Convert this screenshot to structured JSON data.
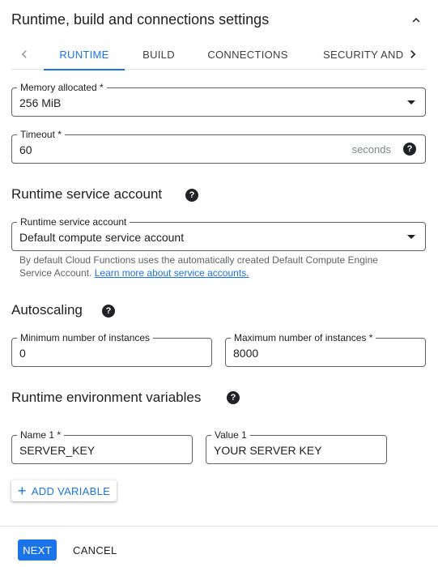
{
  "section": {
    "title": "Runtime, build and connections settings",
    "collapse_icon": "chevron-up-icon"
  },
  "tabs": [
    {
      "label": "RUNTIME",
      "active": true
    },
    {
      "label": "BUILD",
      "active": false
    },
    {
      "label": "CONNECTIONS",
      "active": false
    },
    {
      "label": "SECURITY AND",
      "active": false
    }
  ],
  "memory": {
    "label": "Memory allocated *",
    "value": "256 MiB"
  },
  "timeout": {
    "label": "Timeout *",
    "value": "60",
    "suffix": "seconds"
  },
  "service_account": {
    "heading": "Runtime service account",
    "label": "Runtime service account",
    "value": "Default compute service account",
    "hint_line1": "By default Cloud Functions uses the automatically created Default Compute Engine",
    "hint_line2_prefix": "Service Account. ",
    "hint_link": "Learn more about service accounts."
  },
  "autoscaling": {
    "heading": "Autoscaling",
    "min_label": "Minimum number of instances",
    "min_value": "0",
    "max_label": "Maximum number of instances *",
    "max_value": "8000"
  },
  "env_vars": {
    "heading": "Runtime environment variables",
    "name_label": "Name 1 *",
    "name_value": "SERVER_KEY",
    "value_label": "Value 1",
    "value_value": "YOUR SERVER KEY",
    "add_label": "ADD VARIABLE"
  },
  "footer": {
    "next_label": "NEXT",
    "cancel_label": "CANCEL"
  },
  "colors": {
    "accent": "#1a73e8",
    "text": "#202124",
    "border": "#5f6368",
    "muted": "#5f6368"
  }
}
